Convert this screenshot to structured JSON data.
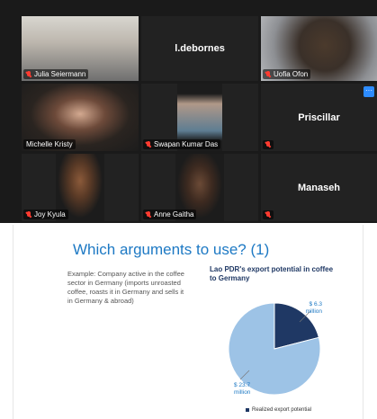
{
  "participants": [
    {
      "name": "Julia Seiermann",
      "video": true
    },
    {
      "name": "l.debornes",
      "video": false
    },
    {
      "name": "Uofia Ofon",
      "video": true
    },
    {
      "name": "Michelle Kristy",
      "video": true,
      "active": true
    },
    {
      "name": "Swapan Kumar Das",
      "video": true
    },
    {
      "name": "Priscillar",
      "video": false
    },
    {
      "name": "Joy Kyula",
      "video": true
    },
    {
      "name": "Anne Gaitha",
      "video": true
    },
    {
      "name": "Manaseh",
      "video": false
    }
  ],
  "tile_more_label": "···",
  "slide": {
    "title": "Which arguments to use? (1)",
    "body": "Example: Company active in  the coffee sector in Germany (imports unroasted coffee, roasts it in Germany and sells it in Germany & abroad)",
    "chart_title": "Lao PDR's export potential in coffee to Germany"
  },
  "chart_data": {
    "type": "pie",
    "title": "Lao PDR's export potential in coffee to Germany",
    "series": [
      {
        "name": "Realized export potential",
        "value": 6.3,
        "label": "$ 6.3 million",
        "color": "#1f3864"
      },
      {
        "name": "",
        "value": 23.7,
        "label": "$ 23.7 million",
        "color": "#9dc3e6"
      }
    ],
    "legend": [
      "Realized export potential"
    ]
  },
  "colors": {
    "accent": "#1d79c4",
    "active_speaker": "#d4d85a",
    "muted": "#ff3b30"
  }
}
